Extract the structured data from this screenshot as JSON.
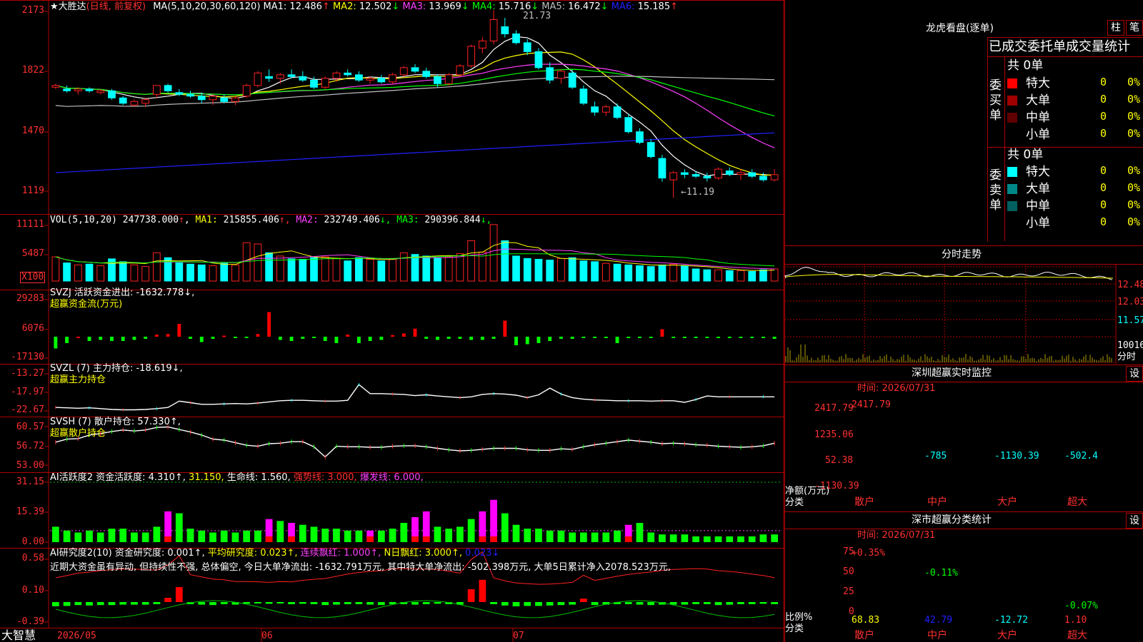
{
  "stock": {
    "name": "★大胜达",
    "mode": "(日线, 前复权)",
    "ma_legend": "MA(5,10,20,30,60,120)",
    "ma": [
      {
        "label": "MA1:",
        "value": "12.486",
        "arrow": "↑",
        "color": "#ffffff"
      },
      {
        "label": "MA2:",
        "value": "12.502",
        "arrow": "↓",
        "color": "#ffff00"
      },
      {
        "label": "MA3:",
        "value": "13.969",
        "arrow": "↓",
        "color": "#ff40ff"
      },
      {
        "label": "MA4:",
        "value": "15.716",
        "arrow": "↓",
        "color": "#00ff00"
      },
      {
        "label": "MA5:",
        "value": "16.472",
        "arrow": "↓",
        "color": "#c0c0c0"
      },
      {
        "label": "MA6:",
        "value": "15.185",
        "arrow": "↑",
        "color": "#2020ff"
      }
    ],
    "price_axis": [
      "2173",
      "1822",
      "1470",
      "1119"
    ],
    "high_label": "21.73",
    "low_label": "←11.19"
  },
  "vol": {
    "legend": "VOL(5,10,20)",
    "value": "247738.000",
    "ma": [
      {
        "label": "MA1:",
        "value": "215855.406",
        "arrow": "↑",
        "color": "#ffff00"
      },
      {
        "label": "MA2:",
        "value": "232749.406",
        "arrow": "↓",
        "color": "#ff40ff"
      },
      {
        "label": "MA3:",
        "value": "290396.844",
        "arrow": "↓",
        "color": "#00ff00"
      }
    ],
    "axis": [
      "11111",
      "5487",
      "X100"
    ]
  },
  "svzj": {
    "legend": "SVZJ  活跃资金进出: -1632.778↓,",
    "sub": "超赢资金流(万元)",
    "axis": [
      "29283",
      "6076",
      "-17130"
    ]
  },
  "svzl": {
    "legend": "SVZL (7) 主力持仓: -18.619↓,",
    "sub": "超赢主力持仓",
    "axis": [
      "-13.27",
      "-17.97",
      "-22.67"
    ]
  },
  "svsh": {
    "legend": "SVSH (7) 散户持仓: 57.330↑,",
    "sub": "超赢散户持仓",
    "axis": [
      "60.57",
      "56.72",
      "53.00"
    ]
  },
  "ai_active": {
    "title": "AI活跃度2",
    "l1": "资金活跃度: 4.310↑,",
    "l2": "31.150,",
    "l3": "生命线: 1.560,",
    "l4": "强势线: 3.000,",
    "l5": "爆发线: 6.000,",
    "axis": [
      "31.15",
      "15.39",
      "0.00"
    ]
  },
  "ai_research": {
    "title": "AI研究度2(10)",
    "l1": "资金研究度: 0.001↑,",
    "l2": "平均研究度: 0.023↑,",
    "l3": "连续飘红: 1.000↑,",
    "l4": "N日飘红: 3.000↑,",
    "l5": "0.023↓",
    "comment": "近期大资金虽有异动, 但持续性不强, 总体偏空, 今日大单净流出: -1632.791万元, 其中特大单净流出: -502.398万元, 大单5日累计净入2078.523万元,",
    "axis": [
      "0.58",
      "0.10",
      "-0.39"
    ]
  },
  "timeline": {
    "brand": "大智慧",
    "labels": [
      "2026/05",
      "06",
      "07"
    ]
  },
  "dragon": {
    "title": "龙虎看盘(逐单)",
    "btn1": "柱",
    "btn2": "笔",
    "header": "已成交委托单成交量统计",
    "buy_total": "共 0单",
    "buy_label": "委买单",
    "sell_total": "共 0单",
    "sell_label": "委卖单",
    "buy_rows": [
      {
        "name": "特大",
        "count": "0",
        "pct": "0%",
        "color": "#ff0000"
      },
      {
        "name": "大单",
        "count": "0",
        "pct": "0%",
        "color": "#a00000"
      },
      {
        "name": "中单",
        "count": "0",
        "pct": "0%",
        "color": "#600000"
      },
      {
        "name": "小单",
        "count": "0",
        "pct": "0%",
        "color": ""
      }
    ],
    "sell_rows": [
      {
        "name": "特大",
        "count": "0",
        "pct": "0%",
        "color": "#00ffff"
      },
      {
        "name": "大单",
        "count": "0",
        "pct": "0%",
        "color": "#008888"
      },
      {
        "name": "中单",
        "count": "0",
        "pct": "0%",
        "color": "#006060"
      },
      {
        "name": "小单",
        "count": "0",
        "pct": "0%",
        "color": ""
      }
    ]
  },
  "minute": {
    "title": "分时走势",
    "axis": [
      "12.48",
      "12.03",
      "11.57",
      "10016",
      "分时"
    ]
  },
  "monitor": {
    "title": "深圳超赢实时监控",
    "btn": "设",
    "time": "时间: 2026/07/31",
    "axis": [
      "2417.79",
      "1235.06",
      "52.38",
      "-1130.39"
    ],
    "ylabel1": "净额(万元)",
    "ylabel2": "分类",
    "cats": [
      "散户",
      "中户",
      "大户",
      "超大"
    ],
    "value_labels": [
      "2417.79",
      "-785",
      "-1130.39",
      "-502.4"
    ]
  },
  "classify": {
    "title": "深市超赢分类统计",
    "btn": "设",
    "time": "时间: 2026/07/31",
    "axis": [
      "75",
      "50",
      "25",
      "0"
    ],
    "ylabel1": "比例%",
    "ylabel2": "分类",
    "cats": [
      "散户",
      "中户",
      "大户",
      "超大"
    ],
    "top_labels": [
      "+0.35%",
      "-0.11%",
      "",
      "-0.07%"
    ],
    "bottom_values": [
      "68.83",
      "42.79",
      "-12.72",
      "1.10"
    ]
  },
  "chart_data": {
    "type": "candlestick",
    "x_labels": [
      "2026/05",
      "06",
      "07"
    ],
    "ohlc": [
      [
        17.4,
        17.6,
        17.3,
        17.5
      ],
      [
        17.3,
        17.5,
        17.1,
        17.2
      ],
      [
        17.2,
        17.4,
        17.0,
        17.3
      ],
      [
        17.3,
        17.4,
        17.1,
        17.2
      ],
      [
        17.1,
        17.3,
        17.0,
        17.2
      ],
      [
        17.2,
        17.3,
        16.7,
        16.8
      ],
      [
        16.8,
        16.9,
        16.4,
        16.5
      ],
      [
        16.4,
        16.7,
        16.3,
        16.6
      ],
      [
        16.5,
        16.8,
        16.3,
        16.7
      ],
      [
        17.0,
        17.5,
        16.8,
        17.5
      ],
      [
        17.5,
        17.6,
        17.1,
        17.2
      ],
      [
        17.1,
        17.3,
        16.9,
        17.0
      ],
      [
        17.0,
        17.2,
        16.8,
        16.9
      ],
      [
        16.9,
        17.1,
        16.5,
        16.7
      ],
      [
        16.7,
        17.0,
        16.4,
        16.9
      ],
      [
        16.8,
        17.0,
        16.5,
        16.6
      ],
      [
        16.6,
        16.9,
        16.4,
        16.8
      ],
      [
        16.9,
        17.6,
        16.8,
        17.5
      ],
      [
        17.5,
        18.3,
        17.4,
        18.2
      ],
      [
        18.0,
        18.4,
        17.7,
        17.9
      ],
      [
        17.9,
        18.2,
        17.6,
        18.1
      ],
      [
        18.1,
        18.4,
        17.9,
        18.0
      ],
      [
        18.0,
        18.3,
        17.7,
        17.8
      ],
      [
        17.8,
        18.0,
        17.3,
        17.4
      ],
      [
        17.4,
        18.0,
        17.3,
        17.9
      ],
      [
        17.9,
        18.3,
        17.7,
        18.2
      ],
      [
        18.2,
        18.4,
        18.0,
        18.1
      ],
      [
        18.1,
        18.3,
        17.7,
        17.8
      ],
      [
        17.8,
        18.0,
        17.6,
        17.9
      ],
      [
        17.9,
        18.1,
        17.6,
        17.7
      ],
      [
        17.7,
        18.2,
        17.6,
        18.1
      ],
      [
        18.1,
        18.6,
        18.0,
        18.5
      ],
      [
        18.5,
        18.7,
        18.2,
        18.3
      ],
      [
        18.3,
        18.5,
        17.9,
        18.0
      ],
      [
        18.0,
        18.1,
        17.4,
        17.6
      ],
      [
        17.6,
        18.2,
        17.5,
        18.1
      ],
      [
        18.1,
        18.7,
        18.0,
        18.6
      ],
      [
        18.6,
        19.8,
        18.5,
        19.7
      ],
      [
        19.6,
        20.2,
        19.3,
        20.0
      ],
      [
        20.0,
        21.73,
        19.8,
        21.2
      ],
      [
        20.8,
        21.3,
        20.2,
        20.4
      ],
      [
        20.4,
        20.6,
        19.8,
        19.9
      ],
      [
        19.9,
        20.1,
        19.2,
        19.4
      ],
      [
        19.4,
        19.6,
        18.4,
        18.5
      ],
      [
        18.5,
        18.8,
        17.6,
        17.8
      ],
      [
        17.9,
        18.4,
        17.6,
        18.3
      ],
      [
        18.2,
        18.4,
        17.3,
        17.4
      ],
      [
        17.3,
        17.5,
        16.4,
        16.5
      ],
      [
        16.3,
        16.6,
        15.8,
        16.0
      ],
      [
        16.0,
        16.4,
        15.8,
        16.3
      ],
      [
        16.3,
        16.5,
        15.6,
        15.7
      ],
      [
        15.7,
        15.9,
        14.8,
        14.9
      ],
      [
        14.9,
        15.1,
        14.2,
        14.3
      ],
      [
        14.3,
        14.5,
        13.4,
        13.5
      ],
      [
        13.4,
        13.6,
        12.1,
        12.3
      ],
      [
        12.2,
        12.7,
        11.19,
        12.6
      ],
      [
        12.6,
        12.8,
        12.3,
        12.5
      ],
      [
        12.5,
        12.7,
        12.3,
        12.4
      ],
      [
        12.4,
        12.6,
        12.1,
        12.3
      ],
      [
        12.3,
        12.9,
        12.2,
        12.8
      ],
      [
        12.7,
        12.9,
        12.4,
        12.5
      ],
      [
        12.5,
        12.8,
        12.2,
        12.6
      ],
      [
        12.6,
        12.8,
        12.3,
        12.4
      ],
      [
        12.4,
        12.6,
        12.1,
        12.2
      ],
      [
        12.2,
        12.8,
        12.1,
        12.49
      ]
    ],
    "volume": [
      60,
      45,
      40,
      42,
      38,
      55,
      48,
      40,
      36,
      70,
      58,
      45,
      42,
      40,
      38,
      44,
      40,
      95,
      92,
      70,
      62,
      55,
      54,
      58,
      60,
      56,
      50,
      58,
      54,
      50,
      56,
      70,
      66,
      62,
      58,
      60,
      68,
      100,
      72,
      140,
      100,
      62,
      56,
      54,
      52,
      56,
      58,
      50,
      48,
      44,
      42,
      40,
      38,
      36,
      40,
      42,
      38,
      30,
      28,
      28,
      26,
      26,
      24,
      28,
      30
    ],
    "svzj": [
      -110,
      -60,
      0,
      -40,
      -30,
      -40,
      -40,
      -30,
      -20,
      20,
      25,
      120,
      -20,
      -50,
      -20,
      10,
      -10,
      -10,
      25,
      230,
      -30,
      -40,
      -20,
      -10,
      -40,
      -60,
      20,
      -60,
      -40,
      -30,
      15,
      30,
      75,
      -20,
      -30,
      -20,
      -20,
      -30,
      -30,
      -20,
      150,
      -80,
      -70,
      -60,
      -40,
      -20,
      -20,
      -10,
      -10,
      -10,
      -60,
      -10,
      -10,
      -10,
      70,
      -10,
      -10,
      -10,
      -10,
      -10,
      -10,
      -10,
      -10,
      -10,
      -20
    ],
    "svzl": [
      -21.8,
      -21.9,
      -22.0,
      -21.9,
      -22.1,
      -22.3,
      -22.4,
      -22.4,
      -22.3,
      -22.1,
      -21.8,
      -20.2,
      -20.6,
      -21.0,
      -21.0,
      -20.9,
      -20.8,
      -20.9,
      -20.7,
      -20.4,
      -20.1,
      -20.0,
      -20.0,
      -20.1,
      -20.2,
      -20.2,
      -20.0,
      -16.0,
      -18.3,
      -18.3,
      -18.4,
      -18.5,
      -18.8,
      -18.6,
      -18.9,
      -19.1,
      -19.3,
      -19.1,
      -18.5,
      -18.3,
      -18.4,
      -18.7,
      -19.3,
      -18.6,
      -16.9,
      -18.4,
      -19.3,
      -19.7,
      -19.9,
      -20.0,
      -20.1,
      -20.1,
      -20.1,
      -20.2,
      -20.1,
      -20.1,
      -20.5,
      -19.8,
      -18.9,
      -19.1,
      -19.1,
      -19.1,
      -19.1,
      -19.1,
      -19.1
    ],
    "svsh": [
      57.5,
      58.1,
      58.2,
      58.9,
      59.2,
      59.6,
      59.9,
      59.7,
      59.9,
      60.4,
      60.5,
      60.0,
      59.5,
      58.9,
      58.1,
      57.9,
      57.4,
      56.9,
      56.7,
      57.2,
      57.3,
      57.6,
      57.6,
      56.6,
      54.6,
      56.7,
      56.6,
      56.6,
      56.5,
      56.5,
      56.7,
      56.8,
      56.8,
      56.6,
      56.3,
      56.0,
      55.8,
      55.9,
      56.1,
      56.3,
      56.3,
      56.3,
      56.0,
      55.9,
      55.9,
      56.2,
      56.1,
      56.6,
      57.0,
      57.3,
      57.6,
      57.9,
      57.7,
      57.5,
      57.2,
      57.3,
      57.2,
      57.0,
      56.9,
      56.7,
      56.6,
      56.5,
      56.6,
      56.8,
      57.3
    ],
    "active": [
      8,
      6,
      5,
      6,
      5,
      7,
      7,
      5,
      5,
      8,
      16,
      15,
      7,
      6,
      5,
      6,
      5,
      6,
      6,
      12,
      11,
      10,
      9,
      8,
      7,
      7,
      6,
      6,
      6,
      6,
      7,
      10,
      13,
      16,
      8,
      7,
      8,
      12,
      16,
      22,
      15,
      9,
      7,
      7,
      6,
      6,
      5,
      5,
      5,
      5,
      6,
      9,
      10,
      5,
      4,
      4,
      4,
      3,
      3,
      3,
      3,
      3,
      3,
      4,
      4
    ],
    "active_magenta": [
      0,
      0,
      0,
      0,
      0,
      0,
      0,
      0,
      0,
      0,
      1,
      0,
      0,
      0,
      0,
      0,
      0,
      0,
      0,
      1,
      0,
      1,
      0,
      0,
      0,
      0,
      0,
      0,
      1,
      0,
      0,
      0,
      1,
      1,
      0,
      0,
      0,
      0,
      1,
      1,
      0,
      0,
      0,
      0,
      0,
      0,
      0,
      0,
      0,
      0,
      0,
      1,
      0,
      0,
      0,
      0,
      0,
      0,
      0,
      0,
      0,
      0,
      0,
      0,
      0
    ],
    "research": [
      -0.1,
      -0.09,
      -0.07,
      -0.08,
      -0.07,
      -0.07,
      -0.06,
      -0.06,
      -0.06,
      -0.05,
      0.1,
      0.35,
      -0.05,
      -0.06,
      -0.07,
      -0.05,
      -0.06,
      -0.04,
      -0.03,
      -0.04,
      -0.03,
      -0.05,
      -0.04,
      -0.05,
      -0.07,
      -0.06,
      -0.05,
      -0.05,
      -0.06,
      -0.07,
      -0.05,
      -0.05,
      -0.06,
      -0.05,
      -0.04,
      -0.05,
      -0.06,
      0.3,
      0.52,
      -0.05,
      -0.08,
      -0.1,
      -0.09,
      -0.09,
      -0.08,
      -0.07,
      -0.06,
      0.08,
      -0.07,
      -0.06,
      -0.05,
      -0.05,
      -0.06,
      -0.07,
      -0.06,
      -0.06,
      -0.06,
      -0.05,
      -0.05,
      -0.07,
      -0.06,
      -0.05,
      -0.05,
      -0.04,
      -0.05
    ],
    "monitor_values": [
      2417.79,
      -785,
      -1130.39,
      -502.4
    ],
    "classify_values": [
      68.83,
      42.79,
      -12.72,
      1.1
    ],
    "price_ylim": [
      11.19,
      21.73
    ],
    "colors": {
      "up": "#ff2020",
      "down": "#00ffff",
      "grid": "#b00000"
    }
  }
}
